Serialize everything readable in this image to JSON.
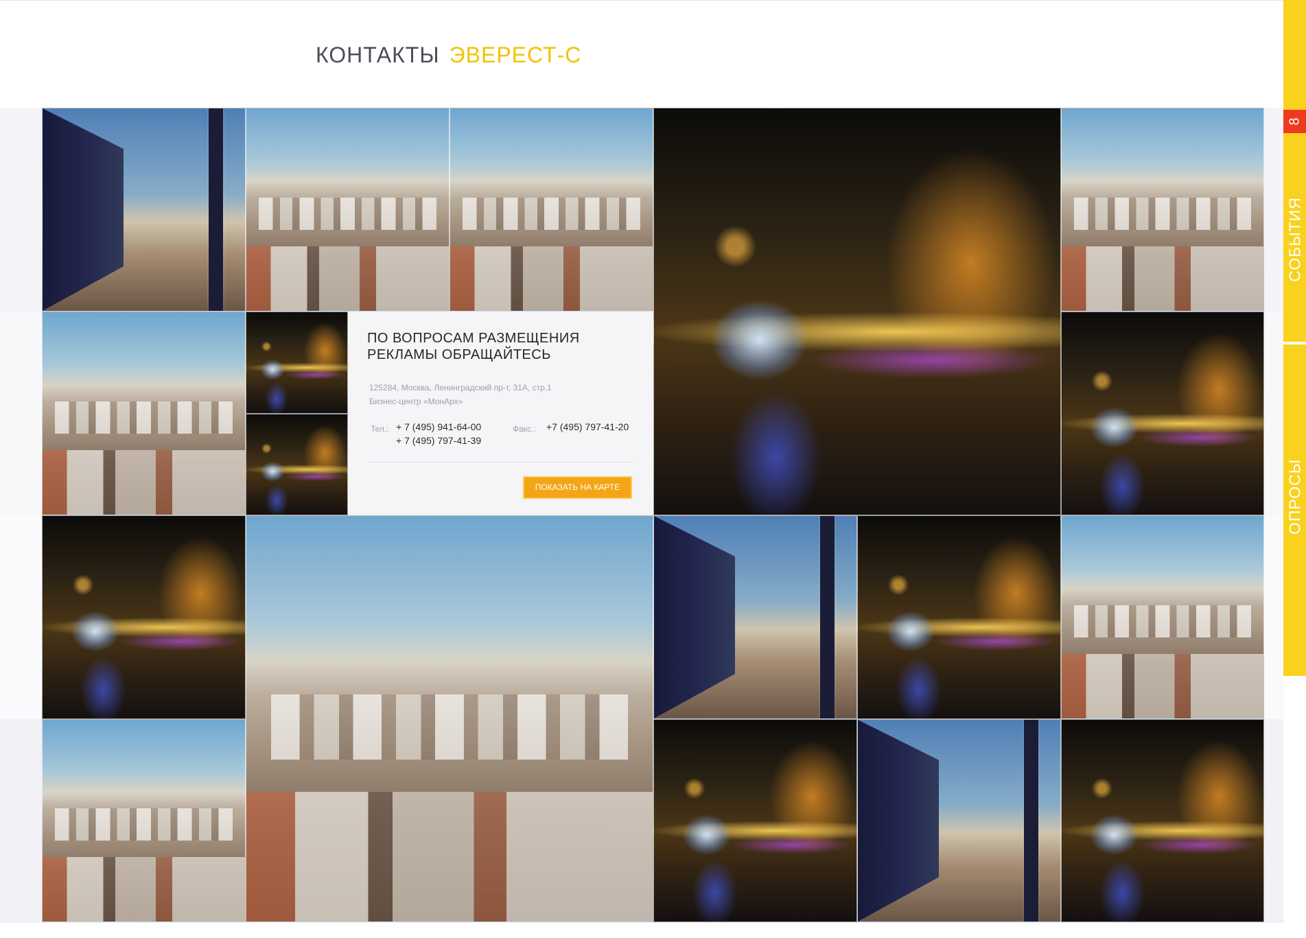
{
  "header": {
    "title_part1": "КОНТАКТЫ",
    "title_part2": "ЭВЕРЕСТ-С"
  },
  "contact_card": {
    "title_line1": "ПО ВОПРОСАМ РАЗМЕЩЕНИЯ",
    "title_line2": "РЕКЛАМЫ ОБРАЩАЙТЕСЬ",
    "address_line1": "125284, Москва, Ленинградский пр-т, 31А, стр.1",
    "address_line2": "Бизнес-центр «МонАрх»",
    "phone_label": "Тел.:",
    "phone_1": "+ 7 (495) 941-64-00",
    "phone_2": "+ 7 (495) 797-41-39",
    "fax_label": "Факс.:",
    "fax": "+7 (495) 797-41-20",
    "map_button": "ПОКАЗАТЬ НА КАРТЕ"
  },
  "side_tabs": {
    "events_label": "СОБЫТИЯ",
    "events_count": "8",
    "polls_label": "ОПРОСЫ"
  },
  "colors": {
    "accent_yellow": "#f2c300",
    "button_orange": "#f3a515",
    "badge_red": "#ee3b1f",
    "side_tab_yellow": "#f8d21e"
  }
}
